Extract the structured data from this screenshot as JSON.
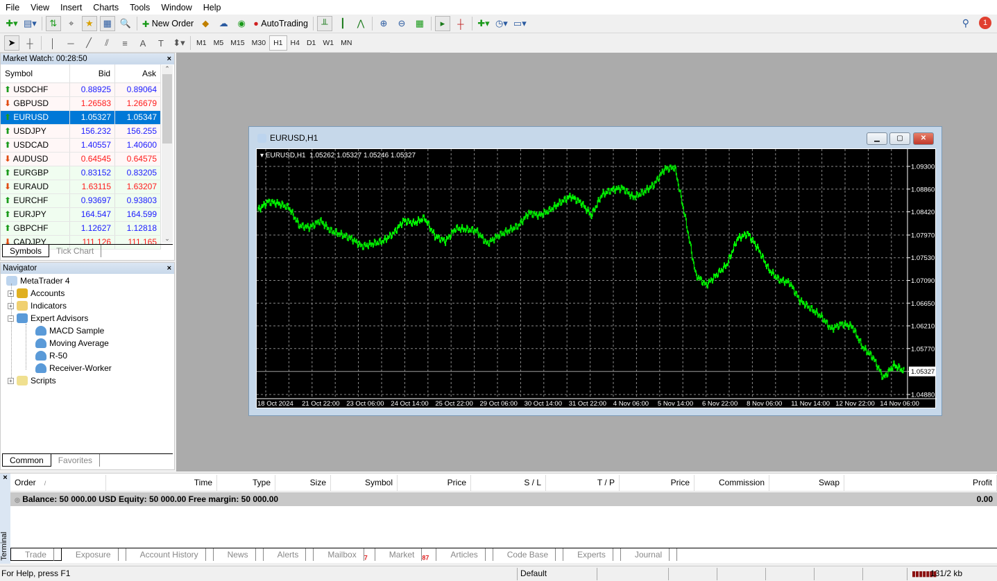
{
  "menu": [
    "File",
    "View",
    "Insert",
    "Charts",
    "Tools",
    "Window",
    "Help"
  ],
  "toolbar": {
    "new_order": "New Order",
    "autotrading": "AutoTrading",
    "timeframes": [
      "M1",
      "M5",
      "M15",
      "M30",
      "H1",
      "H4",
      "D1",
      "W1",
      "MN"
    ],
    "active_timeframe": "H1",
    "notification_count": "1"
  },
  "market_watch": {
    "title": "Market Watch: 00:28:50",
    "columns": [
      "Symbol",
      "Bid",
      "Ask"
    ],
    "rows": [
      {
        "symbol": "USDCHF",
        "bid": "0.88925",
        "ask": "0.89064",
        "dir": "up"
      },
      {
        "symbol": "GBPUSD",
        "bid": "1.26583",
        "ask": "1.26679",
        "dir": "down"
      },
      {
        "symbol": "EURUSD",
        "bid": "1.05327",
        "ask": "1.05347",
        "dir": "up",
        "selected": true
      },
      {
        "symbol": "USDJPY",
        "bid": "156.232",
        "ask": "156.255",
        "dir": "up"
      },
      {
        "symbol": "USDCAD",
        "bid": "1.40557",
        "ask": "1.40600",
        "dir": "up"
      },
      {
        "symbol": "AUDUSD",
        "bid": "0.64545",
        "ask": "0.64575",
        "dir": "down"
      },
      {
        "symbol": "EURGBP",
        "bid": "0.83152",
        "ask": "0.83205",
        "dir": "up"
      },
      {
        "symbol": "EURAUD",
        "bid": "1.63115",
        "ask": "1.63207",
        "dir": "down"
      },
      {
        "symbol": "EURCHF",
        "bid": "0.93697",
        "ask": "0.93803",
        "dir": "up"
      },
      {
        "symbol": "EURJPY",
        "bid": "164.547",
        "ask": "164.599",
        "dir": "up"
      },
      {
        "symbol": "GBPCHF",
        "bid": "1.12627",
        "ask": "1.12818",
        "dir": "up"
      },
      {
        "symbol": "CADJPY",
        "bid": "111.126",
        "ask": "111.165",
        "dir": "down"
      }
    ],
    "tabs": [
      "Symbols",
      "Tick Chart"
    ]
  },
  "navigator": {
    "title": "Navigator",
    "root": "MetaTrader 4",
    "items": [
      {
        "label": "Accounts",
        "expand": "+"
      },
      {
        "label": "Indicators",
        "expand": "+"
      },
      {
        "label": "Expert Advisors",
        "expand": "−"
      }
    ],
    "experts": [
      "MACD Sample",
      "Moving Average",
      "R-50",
      "Receiver-Worker"
    ],
    "scripts": "Scripts",
    "tabs": [
      "Common",
      "Favorites"
    ]
  },
  "chart_window": {
    "title": "EURUSD,H1",
    "header": "EURUSD,H1  1.05262 1.05327 1.05246 1.05327",
    "bar_color": "#00ff00",
    "price_labels": [
      "1.09300",
      "1.08860",
      "1.08420",
      "1.07970",
      "1.07530",
      "1.07090",
      "1.06650",
      "1.06210",
      "1.05770",
      "1.05327",
      "1.04880"
    ],
    "current_price": "1.05327",
    "time_labels": [
      "18 Oct 2024",
      "21 Oct 22:00",
      "23 Oct 06:00",
      "24 Oct 14:00",
      "25 Oct 22:00",
      "29 Oct 06:00",
      "30 Oct 14:00",
      "31 Oct 22:00",
      "4 Nov 06:00",
      "5 Nov 14:00",
      "6 Nov 22:00",
      "8 Nov 06:00",
      "11 Nov 14:00",
      "12 Nov 22:00",
      "14 Nov 06:00"
    ],
    "closes": [
      1.0845,
      1.0862,
      1.0858,
      1.085,
      1.0815,
      1.0812,
      1.0825,
      1.0805,
      1.0798,
      1.079,
      1.0775,
      1.078,
      1.0785,
      1.08,
      1.0825,
      1.082,
      1.083,
      1.0795,
      1.0785,
      1.081,
      1.0808,
      1.0805,
      1.078,
      1.0795,
      1.0805,
      1.0815,
      1.084,
      1.0835,
      1.0845,
      1.086,
      1.0872,
      1.086,
      1.0835,
      1.0875,
      1.0885,
      1.0888,
      1.087,
      1.088,
      1.0895,
      1.0925,
      1.0928,
      1.083,
      1.072,
      1.07,
      1.072,
      1.074,
      1.079,
      1.08,
      1.077,
      1.073,
      1.071,
      1.0705,
      1.067,
      1.0655,
      1.064,
      1.0615,
      1.0625,
      1.062,
      1.058,
      1.056,
      1.052,
      1.0545,
      1.0533
    ]
  },
  "terminal": {
    "label": "Terminal",
    "columns": [
      "Order",
      "Time",
      "Type",
      "Size",
      "Symbol",
      "Price",
      "S / L",
      "T / P",
      "Price",
      "Commission",
      "Swap",
      "Profit"
    ],
    "balance": "Balance: 50 000.00 USD  Equity: 50 000.00  Free margin: 50 000.00",
    "profit": "0.00",
    "tabs": [
      {
        "label": "Trade"
      },
      {
        "label": "Exposure"
      },
      {
        "label": "Account History"
      },
      {
        "label": "News"
      },
      {
        "label": "Alerts"
      },
      {
        "label": "Mailbox",
        "badge": "7"
      },
      {
        "label": "Market",
        "badge": "87"
      },
      {
        "label": "Articles"
      },
      {
        "label": "Code Base"
      },
      {
        "label": "Experts"
      },
      {
        "label": "Journal"
      }
    ]
  },
  "status": {
    "help": "For Help, press F1",
    "profile": "Default",
    "traffic": "131/2 kb"
  }
}
